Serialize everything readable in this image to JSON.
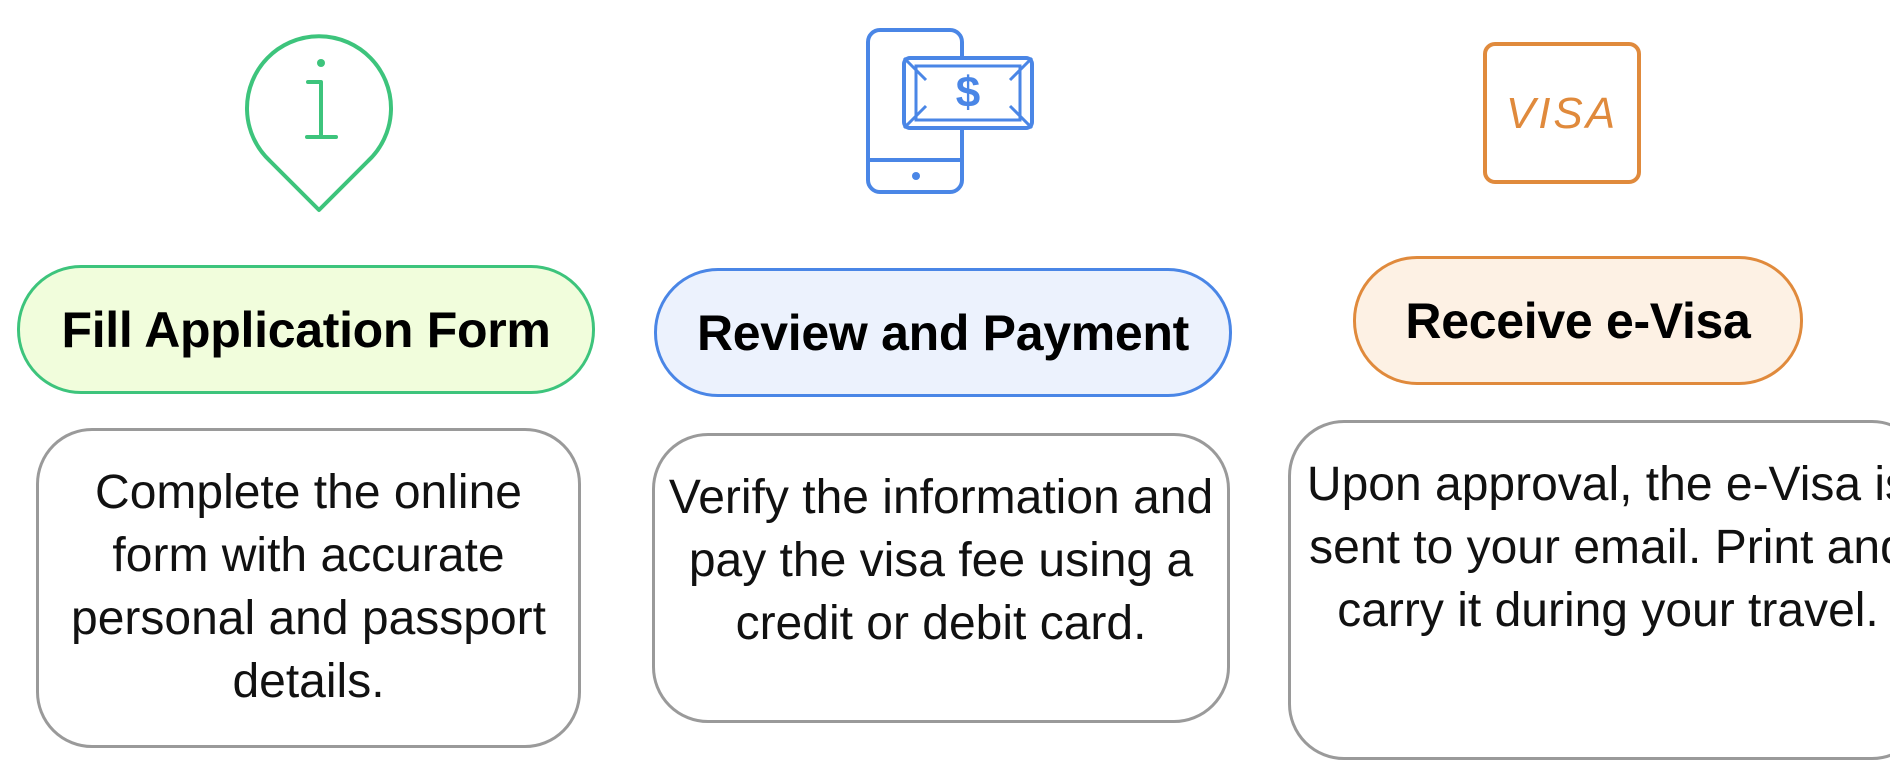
{
  "colors": {
    "step1_accent": "#3dc47c",
    "step1_fill": "#f1fddc",
    "step2_accent": "#4a86e6",
    "step2_fill": "#ecf2fd",
    "step3_accent": "#e08a3c",
    "step3_fill": "#fdf1e4",
    "description_border": "#9a9a9a"
  },
  "steps": [
    {
      "icon": "info-location-pin-icon",
      "title": "Fill Application Form",
      "description": "Complete the online form with accurate personal and passport details."
    },
    {
      "icon": "mobile-payment-icon",
      "currency_symbol": "$",
      "title": "Review and Payment",
      "description": "Verify the information and pay the visa fee using a credit or debit card."
    },
    {
      "icon": "visa-card-icon",
      "badge_text": "VISA",
      "title": "Receive e-Visa",
      "description": "Upon approval, the e-Visa is sent to your email. Print and carry it during your travel."
    }
  ]
}
